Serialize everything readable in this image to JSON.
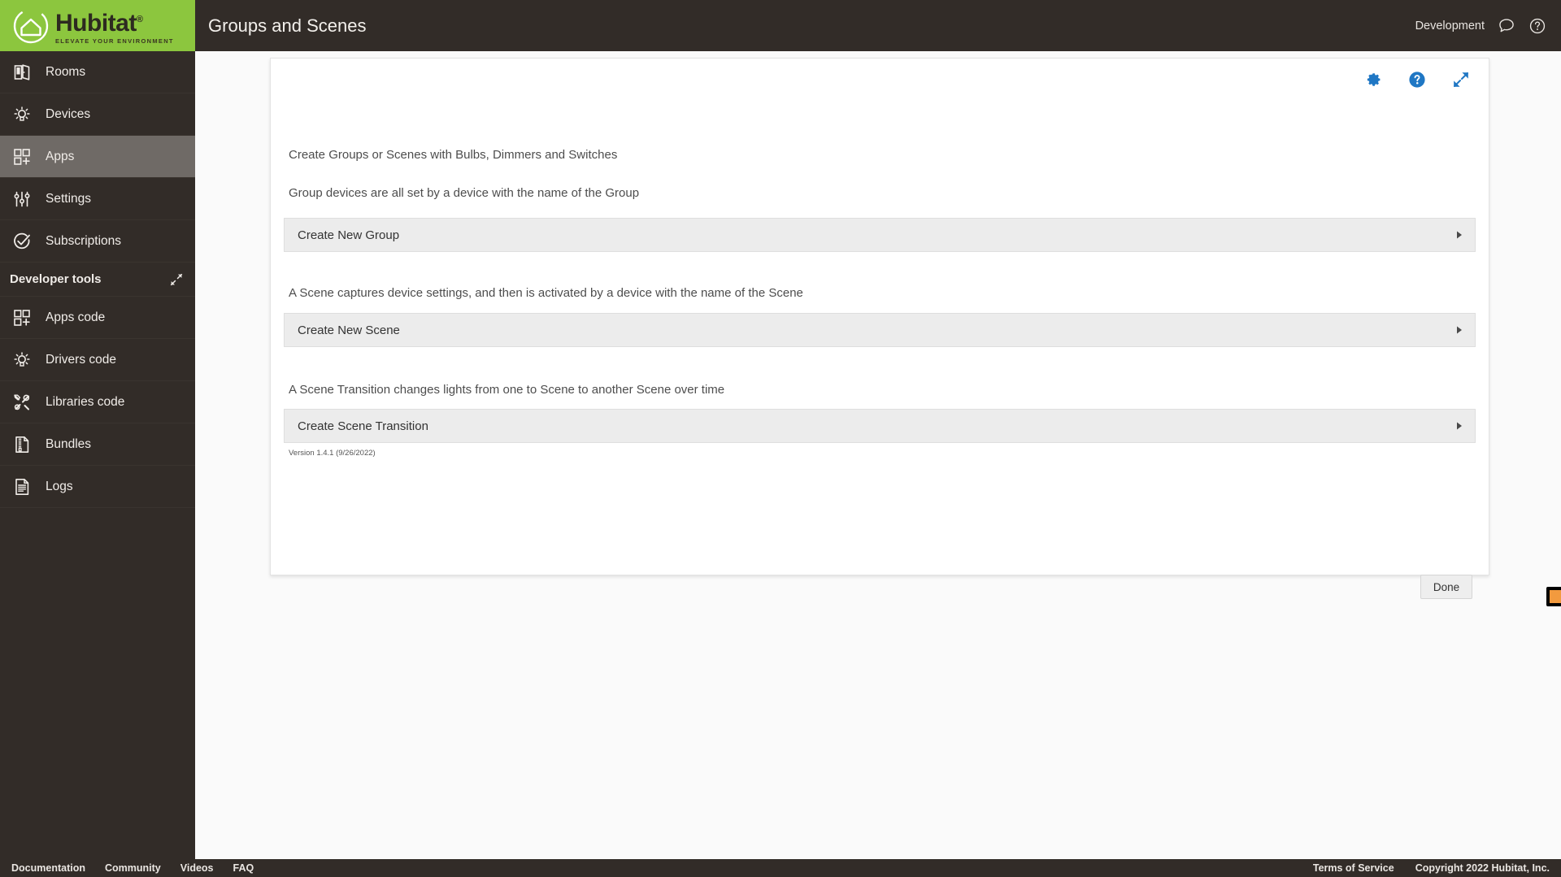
{
  "brand": {
    "name": "Hubitat",
    "registered": "®",
    "tagline": "ELEVATE YOUR ENVIRONMENT",
    "green": "#8cc63e",
    "dark": "#322c28"
  },
  "header": {
    "title": "Groups and Scenes",
    "environment": "Development",
    "chat_icon": "chat-bubble-icon",
    "help_icon": "question-circle-icon"
  },
  "sidebar": {
    "items": [
      {
        "label": "Rooms",
        "icon": "rooms-door-icon",
        "active": false
      },
      {
        "label": "Devices",
        "icon": "lightbulb-icon",
        "active": false
      },
      {
        "label": "Apps",
        "icon": "apps-grid-plus-icon",
        "active": true
      },
      {
        "label": "Settings",
        "icon": "sliders-icon",
        "active": false
      },
      {
        "label": "Subscriptions",
        "icon": "check-circle-icon",
        "active": false
      }
    ],
    "developer_tools": {
      "label": "Developer tools",
      "collapse_icon": "collapse-arrows-icon",
      "items": [
        {
          "label": "Apps code",
          "icon": "apps-grid-plus-icon"
        },
        {
          "label": "Drivers code",
          "icon": "lightbulb-icon"
        },
        {
          "label": "Libraries code",
          "icon": "tools-wrench-screwdriver-icon"
        },
        {
          "label": "Bundles",
          "icon": "zip-file-icon"
        },
        {
          "label": "Logs",
          "icon": "document-lines-icon"
        }
      ]
    }
  },
  "card": {
    "tools": [
      {
        "name": "gear-icon",
        "color": "#1f77c4"
      },
      {
        "name": "question-circle-icon",
        "color": "#1f77c4"
      },
      {
        "name": "expand-arrows-icon",
        "color": "#1f77c4"
      }
    ],
    "blurb_1": "Create Groups or Scenes with Bulbs, Dimmers and Switches",
    "blurb_2": "Group devices are all set by a device with the name of the Group",
    "accordion_group": "Create New Group",
    "blurb_3": "A Scene captures device settings, and then is activated by a device with the name of the Scene",
    "accordion_scene": "Create New Scene",
    "blurb_4": "A Scene Transition changes lights from one to Scene to another Scene over time",
    "accordion_transition": "Create Scene Transition",
    "version": "Version 1.4.1 (9/26/2022)",
    "done_label": "Done",
    "annotation": {
      "name": "orange-pointer-arrow",
      "fill": "#f29a3e",
      "stroke": "#000000",
      "points_to": "Done"
    }
  },
  "footer": {
    "links": [
      "Documentation",
      "Community",
      "Videos",
      "FAQ"
    ],
    "terms": "Terms of Service",
    "copyright": "Copyright 2022 Hubitat, Inc."
  }
}
